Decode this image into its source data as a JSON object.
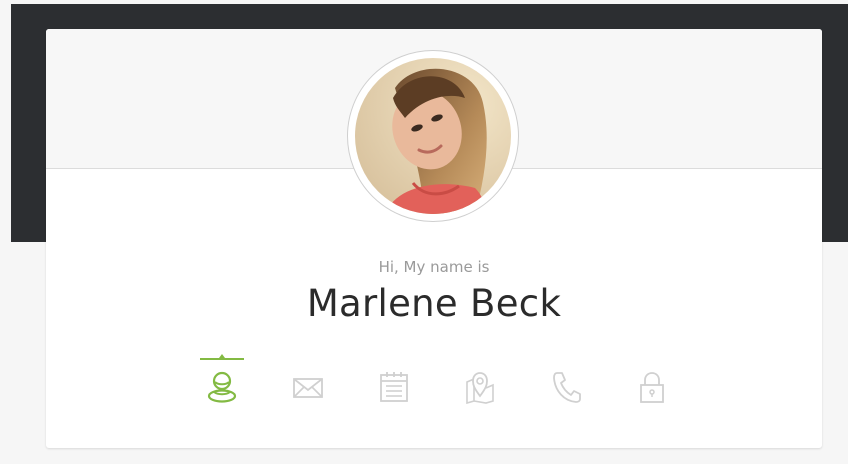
{
  "profile": {
    "greeting": "Hi, My name is",
    "name": "Marlene Beck"
  },
  "tabs": [
    {
      "icon": "user-icon",
      "active": true
    },
    {
      "icon": "mail-icon",
      "active": false
    },
    {
      "icon": "calendar-icon",
      "active": false
    },
    {
      "icon": "map-pin-icon",
      "active": false
    },
    {
      "icon": "phone-icon",
      "active": false
    },
    {
      "icon": "lock-icon",
      "active": false
    }
  ],
  "colors": {
    "accent": "#83ba43",
    "inactive_icon": "#d0d0d0",
    "header_dark": "#2c2e31"
  }
}
